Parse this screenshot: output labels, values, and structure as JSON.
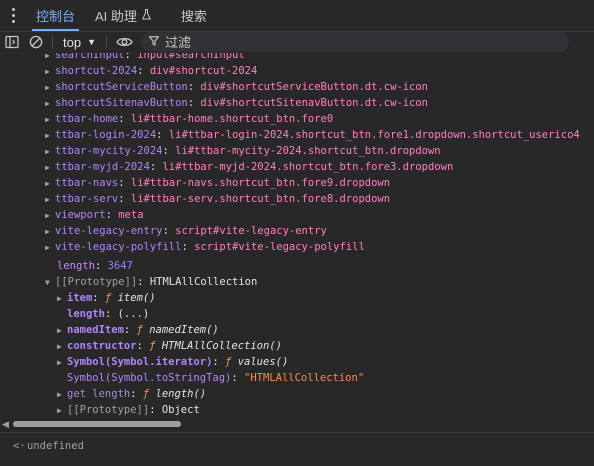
{
  "tabs": [
    {
      "label": "控制台"
    },
    {
      "label": "AI 助理"
    },
    {
      "label": "搜索"
    }
  ],
  "toolbar": {
    "context": "top",
    "filter_placeholder": "过滤"
  },
  "lines": [
    {
      "k": "searchInput",
      "v": "input#searchInput"
    },
    {
      "k": "shortcut-2024",
      "v": "div#shortcut-2024"
    },
    {
      "k": "shortcutServiceButton",
      "v": "div#shortcutServiceButton.dt.cw-icon"
    },
    {
      "k": "shortcutSitenavButton",
      "v": "div#shortcutSitenavButton.dt.cw-icon"
    },
    {
      "k": "ttbar-home",
      "v": "li#ttbar-home.shortcut_btn.fore0"
    },
    {
      "k": "ttbar-login-2024",
      "v": "li#ttbar-login-2024.shortcut_btn.fore1.dropdown.shortcut_userico4"
    },
    {
      "k": "ttbar-mycity-2024",
      "v": "li#ttbar-mycity-2024.shortcut_btn.dropdown"
    },
    {
      "k": "ttbar-myjd-2024",
      "v": "li#ttbar-myjd-2024.shortcut_btn.fore3.dropdown"
    },
    {
      "k": "ttbar-navs",
      "v": "li#ttbar-navs.shortcut_btn.fore9.dropdown"
    },
    {
      "k": "ttbar-serv",
      "v": "li#ttbar-serv.shortcut_btn.fore8.dropdown"
    },
    {
      "k": "viewport",
      "v": "meta"
    },
    {
      "k": "vite-legacy-entry",
      "v": "script#vite-legacy-entry"
    },
    {
      "k": "vite-legacy-polyfill",
      "v": "script#vite-legacy-polyfill"
    }
  ],
  "length": {
    "k": "length",
    "v": "3647"
  },
  "prototype": {
    "k": "[[Prototype]]",
    "v": "HTMLAllCollection"
  },
  "proto_members": [
    {
      "k": "item",
      "f": "ƒ",
      "v": "item()"
    },
    {
      "k": "length",
      "v": "(...)"
    },
    {
      "k": "namedItem",
      "f": "ƒ",
      "v": "namedItem()"
    },
    {
      "k": "constructor",
      "f": "ƒ",
      "v": "HTMLAllCollection()"
    },
    {
      "k": "Symbol(Symbol.iterator)",
      "f": "ƒ",
      "v": "values()"
    },
    {
      "k": "Symbol(Symbol.toStringTag)",
      "v": "\"HTMLAllCollection\""
    },
    {
      "k": "get length",
      "f": "ƒ",
      "v": "length()"
    },
    {
      "k": "[[Prototype]]",
      "v": "Object"
    }
  ],
  "result": {
    "value": "undefined"
  }
}
